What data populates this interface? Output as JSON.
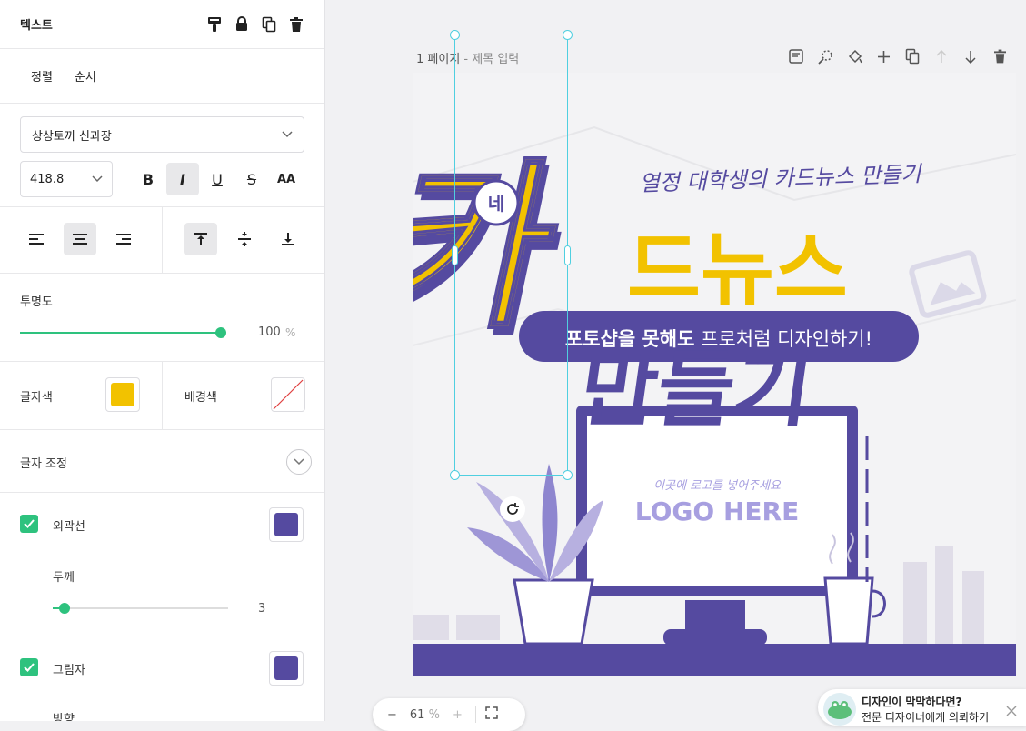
{
  "panel": {
    "title": "텍스트",
    "tabs": [
      "정렬",
      "순서"
    ],
    "font_family": "상상토끼 신과장",
    "font_size": "418.8",
    "format_buttons": [
      "B",
      "I",
      "U",
      "S",
      "AA"
    ],
    "opacity_label": "투명도",
    "opacity_value": "100",
    "opacity_unit": "%",
    "text_color_label": "글자색",
    "text_color": "#f2c200",
    "bg_color_label": "배경색",
    "adjust_label": "글자 조정",
    "outline_label": "외곽선",
    "outline_color": "#554aa0",
    "thickness_label": "두께",
    "thickness_value": "3",
    "shadow_label": "그림자",
    "shadow_color": "#554aa0",
    "direction_label": "방향"
  },
  "canvas": {
    "page_label": "1 페이지",
    "page_separator": " - ",
    "page_title_placeholder": "제목 입력",
    "headline_small": "열정 대학생의 카드뉴스 만들기",
    "badge": "네",
    "headline_main": "드뉴스",
    "headline_big_left": "카",
    "pill_bold": "포토샵을 못해도",
    "pill_regular": " 프로처럼 디자인하기!",
    "headline_bottom": "만들기",
    "logo_sub": "이곳에 로고를 넣어주세요",
    "logo_main": "LOGO HERE",
    "accent_purple": "#554aa0",
    "accent_yellow": "#f2c200"
  },
  "zoom": {
    "minus": "−",
    "value": "61",
    "unit": "%",
    "plus": "+"
  },
  "help": {
    "title": "디자인이 막막하다면?",
    "subtitle": "전문 디자이너에게 의뢰하기"
  }
}
